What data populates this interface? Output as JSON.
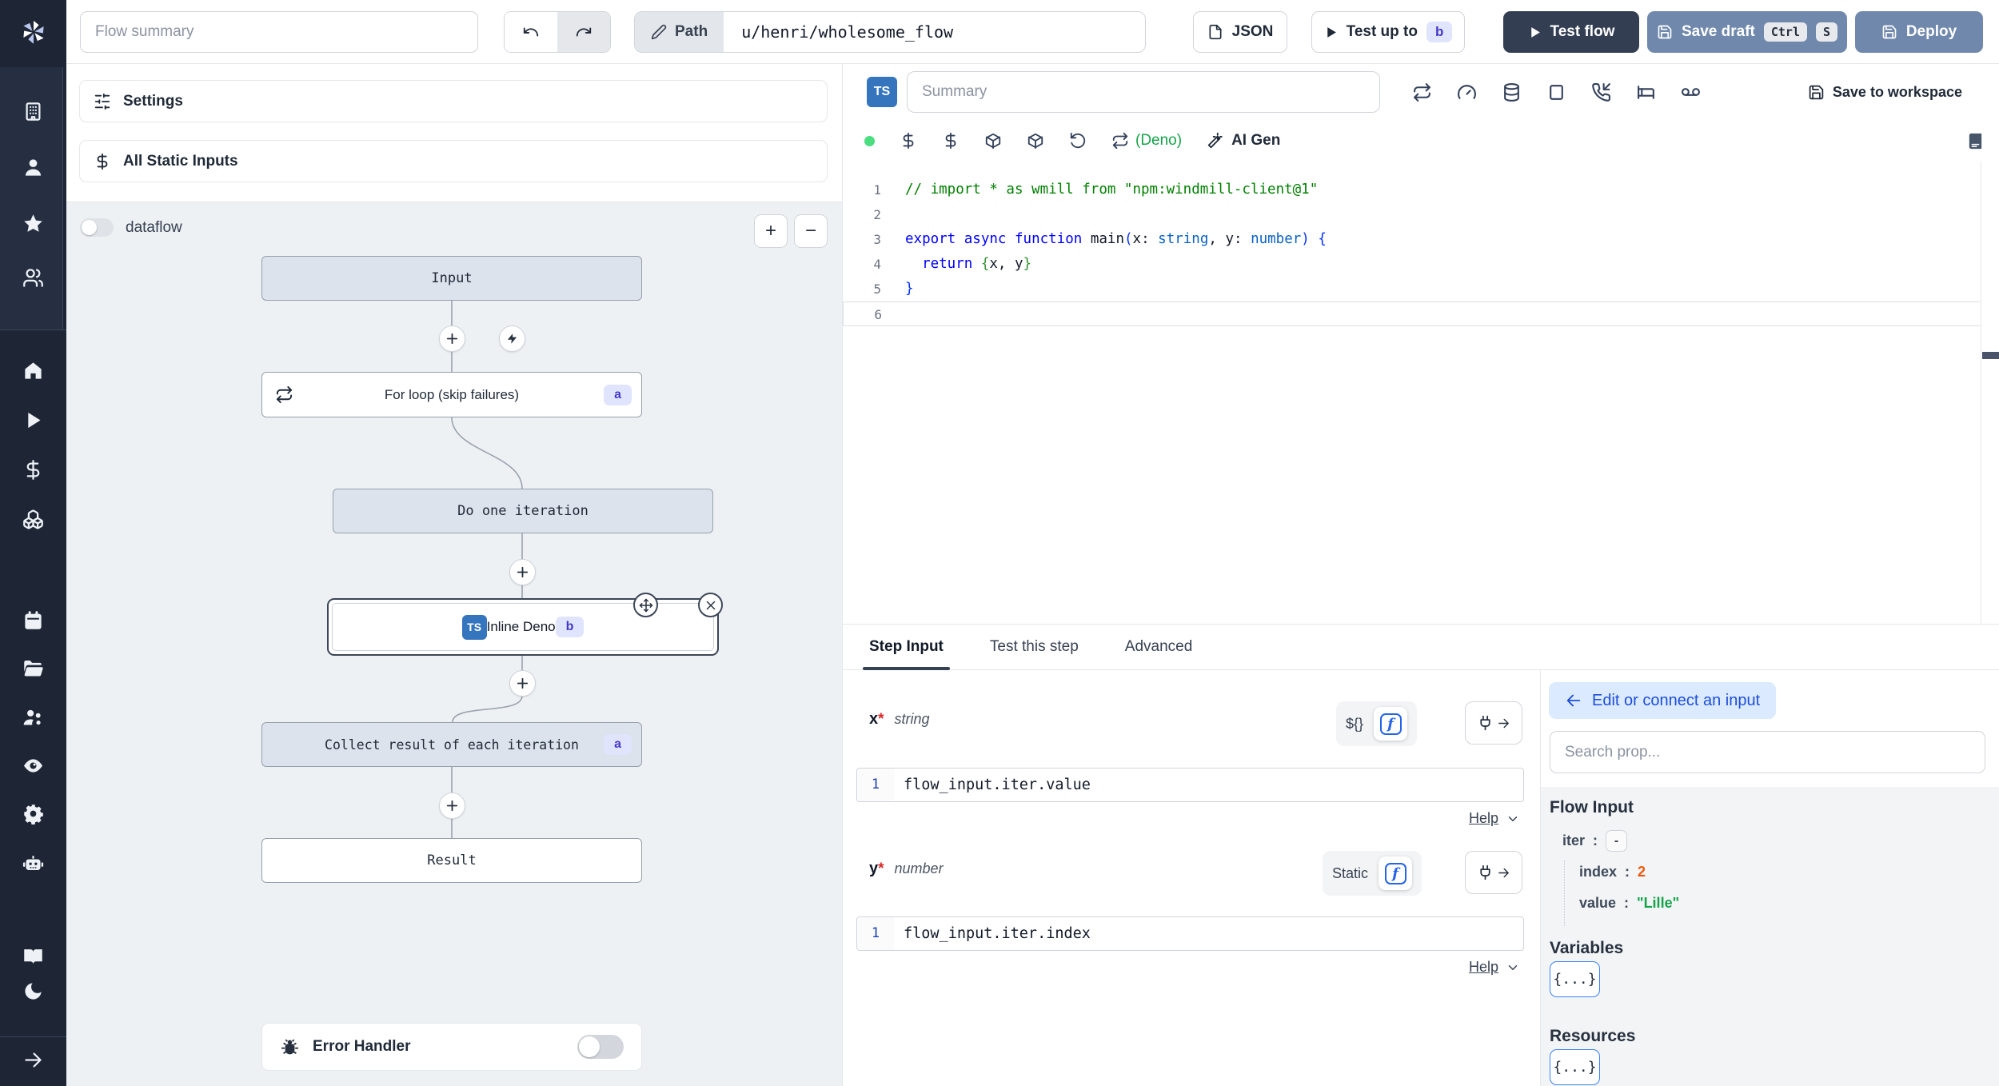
{
  "topbar": {
    "flow_summary_placeholder": "Flow summary",
    "path_label": "Path",
    "path_value": "u/henri/wholesome_flow",
    "json_label": "JSON",
    "test_up_to_label": "Test up to",
    "test_up_to_badge": "b",
    "test_flow_label": "Test flow",
    "save_draft_label": "Save draft",
    "save_draft_kbd1": "Ctrl",
    "save_draft_kbd2": "S",
    "deploy_label": "Deploy"
  },
  "left_panel": {
    "settings_label": "Settings",
    "static_inputs_label": "All Static Inputs",
    "dataflow_label": "dataflow",
    "zoom_in_label": "+",
    "zoom_out_label": "−",
    "error_handler_label": "Error Handler"
  },
  "graph": {
    "input_label": "Input",
    "forloop_label": "For loop (skip failures)",
    "forloop_badge": "a",
    "iteration_label": "Do one iteration",
    "inline_label": "Inline Deno",
    "inline_badge": "b",
    "inline_lang": "TS",
    "collect_label": "Collect result of each iteration",
    "collect_badge": "a",
    "result_label": "Result"
  },
  "editor": {
    "lang_badge": "TS",
    "summary_placeholder": "Summary",
    "save_to_workspace_label": "Save to workspace",
    "deno_label": "(Deno)",
    "ai_gen_label": "AI Gen",
    "code_lines": [
      {
        "n": "1",
        "t": [
          [
            "c",
            "// import * as wmill from \"npm:windmill-client@1\""
          ]
        ]
      },
      {
        "n": "2",
        "t": []
      },
      {
        "n": "3",
        "t": [
          [
            "k",
            "export"
          ],
          [
            "p",
            " "
          ],
          [
            "k",
            "async"
          ],
          [
            "p",
            " "
          ],
          [
            "k",
            "function"
          ],
          [
            "p",
            " main"
          ],
          [
            "b1",
            "("
          ],
          [
            "p",
            "x"
          ],
          [
            "p",
            ": "
          ],
          [
            "ty",
            "string"
          ],
          [
            "p",
            ", "
          ],
          [
            "p",
            "y"
          ],
          [
            "p",
            ": "
          ],
          [
            "ty",
            "number"
          ],
          [
            "b1",
            ")"
          ],
          [
            "p",
            " "
          ],
          [
            "b1",
            "{"
          ]
        ]
      },
      {
        "n": "4",
        "t": [
          [
            "p",
            "  "
          ],
          [
            "k",
            "return"
          ],
          [
            "p",
            " "
          ],
          [
            "b2",
            "{"
          ],
          [
            "p",
            "x, y"
          ],
          [
            "b2",
            "}"
          ]
        ]
      },
      {
        "n": "5",
        "t": [
          [
            "b1",
            "}"
          ]
        ]
      },
      {
        "n": "6",
        "t": [],
        "current": true
      }
    ]
  },
  "step_panel": {
    "tabs": [
      "Step Input",
      "Test this step",
      "Advanced"
    ],
    "fields": [
      {
        "name": "x",
        "required": "*",
        "type": "string",
        "mode": "${}",
        "line_no": "1",
        "value": "flow_input.iter.value",
        "help_label": "Help"
      },
      {
        "name": "y",
        "required": "*",
        "type": "number",
        "mode": "Static",
        "line_no": "1",
        "value": "flow_input.iter.index",
        "help_label": "Help"
      }
    ]
  },
  "props_panel": {
    "edit_connect_label": "Edit or connect an input",
    "search_placeholder": "Search prop...",
    "flow_input_title": "Flow Input",
    "iter_key": "iter",
    "iter_colon": ":",
    "iter_collapse": "-",
    "index_key": "index",
    "index_colon": ":",
    "index_value": "2",
    "value_key": "value",
    "value_colon": ":",
    "value_value": "\"Lille\"",
    "variables_title": "Variables",
    "variables_button": "{...}",
    "resources_title": "Resources",
    "resources_button": "{...}"
  },
  "colors": {
    "sidebar_bg": "#1e2636",
    "dark_button": "#333e52",
    "steel_button": "#6f88ac",
    "badge_bg": "#e0e4fc",
    "badge_text": "#4338ca",
    "ts_blue": "#3575be",
    "deno_green": "#16a34a",
    "number_orange": "#ea580c",
    "string_green": "#16a34a",
    "edit_connect_bg": "#dbeafe",
    "edit_connect_text": "#1d4ed8",
    "graph_bg": "#eef1f4",
    "node_gray_bg": "#dce3ec"
  }
}
